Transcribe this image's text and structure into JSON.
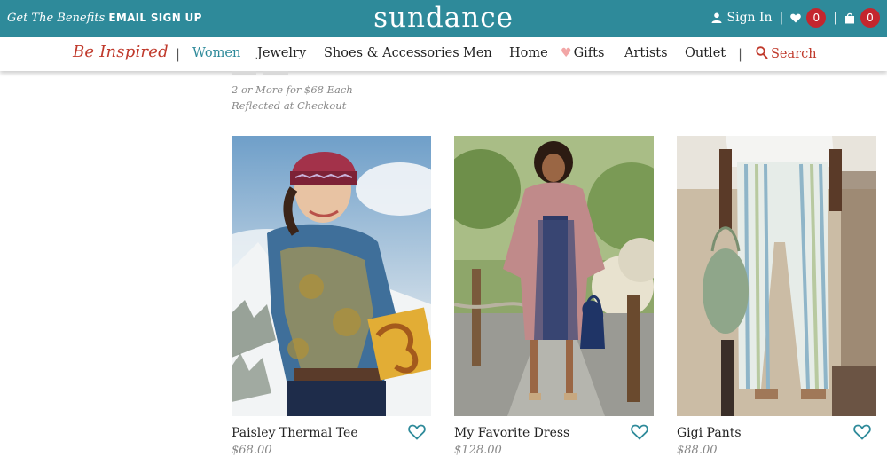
{
  "topbar": {
    "promo_italic": "Get The Benefits",
    "promo_caps": "EMAIL SIGN UP",
    "logo": "sundance",
    "signin_label": "Sign In",
    "wishlist_count": "0",
    "cart_count": "0",
    "separator": "|"
  },
  "nav": {
    "inspired": "Be Inspired",
    "divider": "|",
    "items": [
      {
        "label": "Women"
      },
      {
        "label": "Jewelry"
      },
      {
        "label": "Shoes & Accessories"
      },
      {
        "label": "Men"
      },
      {
        "label": "Home"
      },
      {
        "label": "Gifts"
      },
      {
        "label": "Artists"
      },
      {
        "label": "Outlet"
      }
    ],
    "search_label": "Search"
  },
  "promo_note": {
    "line1": "2 or More for $68 Each",
    "line2": "Reflected at Checkout"
  },
  "products": [
    {
      "name": "Paisley Thermal Tee",
      "price": "$68.00"
    },
    {
      "name": "My Favorite Dress",
      "price": "$128.00"
    },
    {
      "name": "Gigi Pants",
      "price": "$88.00"
    }
  ],
  "colors": {
    "brand_teal": "#2e8a9a",
    "accent_red": "#c0392b",
    "badge_red": "#c4262e"
  }
}
